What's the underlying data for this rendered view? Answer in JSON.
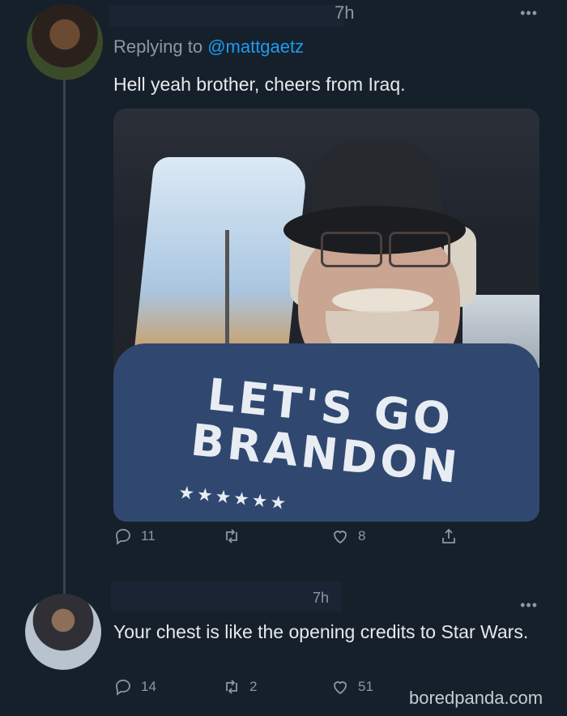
{
  "tweet1": {
    "time": "7h",
    "reply_prefix": "Replying to ",
    "reply_handle": "@mattgaetz",
    "text": "Hell yeah brother, cheers from Iraq.",
    "shirt_line1": "LET'S GO",
    "shirt_line2": "BRANDON",
    "stars": "★★★★★★",
    "reply_count": "11",
    "retweet_count": "",
    "like_count": "8"
  },
  "tweet2": {
    "time": "7h",
    "text": "Your chest is like the opening credits to Star Wars.",
    "reply_count": "14",
    "retweet_count": "2",
    "like_count": "51"
  },
  "watermark": "boredpanda.com",
  "icons": {
    "reply": "reply-icon",
    "retweet": "retweet-icon",
    "like": "heart-icon",
    "share": "share-icon",
    "more": "more-icon"
  },
  "colors": {
    "background": "#15202b",
    "link": "#1d9bf0",
    "muted": "#8b98a5"
  }
}
